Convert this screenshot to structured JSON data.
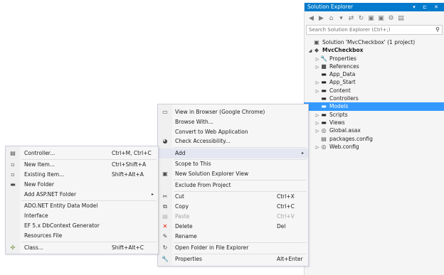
{
  "solution_explorer": {
    "title": "Solution Explorer",
    "title_buttons": "▾ ⊏ ✕",
    "toolbar_icons": [
      "back-icon",
      "forward-icon",
      "home-icon",
      "sync-icon",
      "refresh-icon",
      "collapse-icon",
      "copy-icon",
      "show-all-icon",
      "wrench-icon",
      "preview-icon"
    ],
    "toolbar_glyphs": [
      "◀",
      "▶",
      "⌂",
      "▾",
      "⇄",
      "↻",
      "▣",
      "▣",
      "⚙",
      "▤"
    ],
    "search_placeholder": "Search Solution Explorer (Ctrl+;)",
    "search_glyph": "⚲",
    "items": [
      {
        "label": "Solution 'MvcCheckbox' (1 project)",
        "icon": "▣",
        "twisty": ""
      },
      {
        "label": "MvcCheckbox",
        "icon": "◆",
        "twisty": "◢"
      },
      {
        "label": "Properties",
        "icon": "🔧",
        "twisty": "▷"
      },
      {
        "label": "References",
        "icon": "■",
        "twisty": "▷"
      },
      {
        "label": "App_Data",
        "icon": "▬",
        "twisty": ""
      },
      {
        "label": "App_Start",
        "icon": "▬",
        "twisty": "▷"
      },
      {
        "label": "Content",
        "icon": "▬",
        "twisty": "▷"
      },
      {
        "label": "Controllers",
        "icon": "▬",
        "twisty": ""
      },
      {
        "label": "Models",
        "icon": "▬",
        "twisty": ""
      },
      {
        "label": "Scripts",
        "icon": "▬",
        "twisty": "▷"
      },
      {
        "label": "Views",
        "icon": "▬",
        "twisty": "▷"
      },
      {
        "label": "Global.asax",
        "icon": "◎",
        "twisty": "▷"
      },
      {
        "label": "packages.config",
        "icon": "▤",
        "twisty": ""
      },
      {
        "label": "Web.config",
        "icon": "◎",
        "twisty": "▷"
      }
    ]
  },
  "context_menu": {
    "items": [
      {
        "label": "View in Browser (Google Chrome)",
        "shortcut": "",
        "icon": "▭"
      },
      {
        "label": "Browse With...",
        "shortcut": "",
        "icon": ""
      },
      {
        "label": "Convert to Web Application",
        "shortcut": "",
        "icon": ""
      },
      {
        "label": "Check Accessibility...",
        "shortcut": "",
        "icon": "◕"
      },
      {
        "label": "Add",
        "shortcut": "",
        "icon": "",
        "arrow": "▸"
      },
      {
        "label": "Scope to This",
        "shortcut": "",
        "icon": ""
      },
      {
        "label": "New Solution Explorer View",
        "shortcut": "",
        "icon": "▣"
      },
      {
        "label": "Exclude From Project",
        "shortcut": "",
        "icon": ""
      },
      {
        "label": "Cut",
        "shortcut": "Ctrl+X",
        "icon": "✂"
      },
      {
        "label": "Copy",
        "shortcut": "Ctrl+C",
        "icon": "⧉"
      },
      {
        "label": "Paste",
        "shortcut": "Ctrl+V",
        "icon": "▤"
      },
      {
        "label": "Delete",
        "shortcut": "Del",
        "icon": "✕"
      },
      {
        "label": "Rename",
        "shortcut": "",
        "icon": "✎"
      },
      {
        "label": "Open Folder in File Explorer",
        "shortcut": "",
        "icon": "↻"
      },
      {
        "label": "Properties",
        "shortcut": "Alt+Enter",
        "icon": "🔧"
      }
    ]
  },
  "add_submenu": {
    "items": [
      {
        "label": "Controller...",
        "shortcut": "Ctrl+M, Ctrl+C",
        "icon": "▤"
      },
      {
        "label": "New Item...",
        "shortcut": "Ctrl+Shift+A",
        "icon": "▫"
      },
      {
        "label": "Existing Item...",
        "shortcut": "Shift+Alt+A",
        "icon": "▫"
      },
      {
        "label": "New Folder",
        "shortcut": "",
        "icon": "▬"
      },
      {
        "label": "Add ASP.NET Folder",
        "shortcut": "",
        "icon": "",
        "arrow": "▸"
      },
      {
        "label": "ADO.NET Entity Data Model",
        "shortcut": "",
        "icon": ""
      },
      {
        "label": "Interface",
        "shortcut": "",
        "icon": ""
      },
      {
        "label": "EF 5.x DbContext Generator",
        "shortcut": "",
        "icon": ""
      },
      {
        "label": "Resources File",
        "shortcut": "",
        "icon": ""
      },
      {
        "label": "Class...",
        "shortcut": "Shift+Alt+C",
        "icon": "✣"
      }
    ]
  },
  "colors": {
    "title_bar": "#007acc",
    "selection": "#3399ff",
    "menu_highlight": "#e4e6f1",
    "delete_icon": "#e51400"
  }
}
